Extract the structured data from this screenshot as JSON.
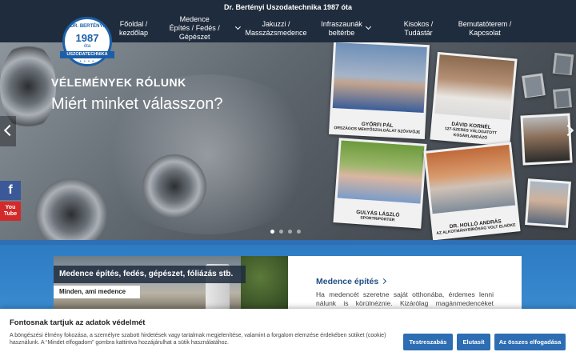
{
  "topbar": {
    "text": "Dr. Bertényi Uszodatechnika 1987 óta"
  },
  "logo": {
    "arc_text": "DR. BERTÉNYI",
    "year": "1987",
    "since": "óta",
    "ribbon": "USZODATECHNIKA",
    "dots": "• • • •"
  },
  "nav": {
    "items": [
      {
        "line1": "Főoldal /",
        "line2": "kezdőlap",
        "dropdown": false
      },
      {
        "line1": "Medence",
        "line2": "Építés / Fedés / Gépészet",
        "dropdown": true
      },
      {
        "line1": "Jakuzzi /",
        "line2": "Masszázsmedence",
        "dropdown": false
      },
      {
        "line1": "Infraszaunák",
        "line2": "beltérbe",
        "dropdown": true
      },
      {
        "line1": "Kisokos /",
        "line2": "Tudástár",
        "dropdown": false
      },
      {
        "line1": "Bemutatóterem /",
        "line2": "Kapcsolat",
        "dropdown": false
      }
    ]
  },
  "hero": {
    "kicker": "VÉLEMÉNYEK RÓLUNK",
    "headline": "Miért minket válasszon?",
    "testimonials": [
      {
        "name": "GYŐRFI PÁL",
        "role": "ORSZÁGOS MENTŐSZOLGÁLAT SZÓVIVŐJE"
      },
      {
        "name": "DÁVID KORNÉL",
        "role": "127-SZERES VÁLOGATOTT KOSÁRLABDÁZÓ"
      },
      {
        "name": "GULYÁS LÁSZLÓ",
        "role": "SPORTRIPORTER"
      },
      {
        "name": "DR. HOLLÓ ANDRÁS",
        "role": "AZ ALKOTMÁNYBÍRÓSÁG VOLT ELNÖKE"
      }
    ],
    "active_slide": 1,
    "slide_count": 4
  },
  "social": {
    "facebook": "f",
    "youtube_line1": "You",
    "youtube_line2": "Tube"
  },
  "section": {
    "image_title": "Medence építés, fedés, gépészet, fóliázás stb.",
    "image_subtitle": "Minden, ami medence",
    "heading": "Medence építés",
    "body": "Ha medencét szeretne saját otthonába, érdemes lenni nálunk is körülnéznie. Kizárólag magánmedencéket építünk"
  },
  "cookie": {
    "title": "Fontosnak tartjuk az adatok védelmét",
    "body": "A böngészési élmény fokozása, a személyre szabott hirdetések vagy tartalmak megjelenítése, valamint a forgalom elemzése érdekében sütiket (cookie) használunk. A “Mindet elfogadom” gombra kattintva hozzájárulhat a sütik használatához.",
    "btn_customize": "Testreszabás",
    "btn_reject": "Elutasít",
    "btn_accept": "Az összes elfogadása"
  },
  "colors": {
    "nav_bg": "#1f2c3d",
    "brand_blue": "#2d6db3",
    "section_blue": "#2d7cc3",
    "heading_blue": "#1f4e84"
  }
}
